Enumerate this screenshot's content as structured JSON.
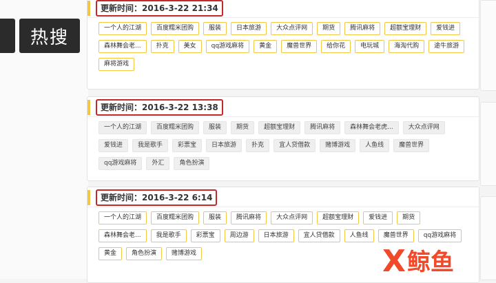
{
  "sidebar": {
    "hot_search_label": "热搜"
  },
  "panels": [
    {
      "time": "更新时间：2016-3-22 21:34",
      "tags": [
        "一个人的江湖",
        "百度糯米团购",
        "服装",
        "日本旅游",
        "大众点评网",
        "期货",
        "腾讯麻将",
        "超额宝理财",
        "爱钱进",
        "森林舞会老...",
        "扑克",
        "美女",
        "qq游戏麻将",
        "黄金",
        "魔兽世界",
        "给你花",
        "电玩城",
        "海淘代购",
        "途牛旅游",
        "麻将游戏"
      ]
    },
    {
      "time": "更新时间：2016-3-22 13:38",
      "tags": [
        "一个人的江湖",
        "百度糯米团购",
        "服装",
        "期货",
        "超额宝理财",
        "腾讯麻将",
        "森林舞会老虎...",
        "大众点评网",
        "爱钱进",
        "我是歌手",
        "彩票宝",
        "日本旅游",
        "扑克",
        "宜人贷借款",
        "赌博游戏",
        "人鱼线",
        "魔兽世界",
        "qq游戏麻将",
        "外汇",
        "角色扮演"
      ]
    },
    {
      "time": "更新时间：2016-3-22 6:14",
      "tags": [
        "一个人的江湖",
        "百度糯米团购",
        "服装",
        "腾讯麻将",
        "大众点评网",
        "超额宝理财",
        "爱钱进",
        "期货",
        "森林舞会老...",
        "我是歌手",
        "彩票宝",
        "周边游",
        "日本旅游",
        "宜人贷借款",
        "人鱼线",
        "魔兽世界",
        "qq游戏麻将",
        "黄金",
        "角色扮演",
        "赌博游戏"
      ]
    }
  ],
  "watermark": {
    "x_mark": "X",
    "text": "鲸鱼"
  },
  "colors": {
    "accent": "#f2c744",
    "highlight": "#c62828",
    "tab_bg": "#2b2b2b",
    "watermark": "#f04a2b"
  }
}
